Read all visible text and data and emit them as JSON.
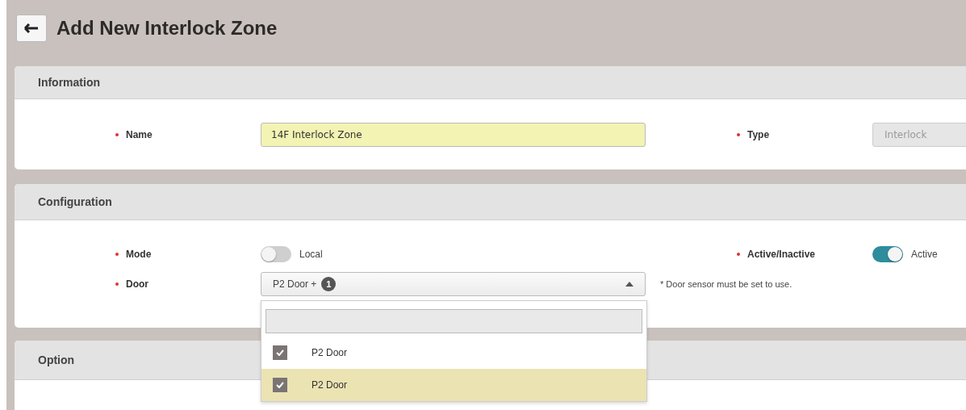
{
  "page": {
    "title": "Add New Interlock Zone"
  },
  "sections": [
    {
      "title": "Information",
      "kind": "information"
    },
    {
      "title": "Configuration",
      "kind": "configuration"
    },
    {
      "title": "Option",
      "kind": "option"
    }
  ],
  "information": {
    "name": {
      "label": "Name",
      "required": true,
      "value": "14F Interlock Zone"
    },
    "type": {
      "label": "Type",
      "required": true,
      "value": "Interlock",
      "disabled": true
    }
  },
  "configuration": {
    "mode": {
      "label": "Mode",
      "required": true,
      "on": false,
      "text": "Local"
    },
    "active": {
      "label": "Active/Inactive",
      "required": true,
      "on": true,
      "text": "Active"
    },
    "door": {
      "label": "Door",
      "required": true,
      "value": "P2 Door +",
      "count": "1",
      "expanded": true,
      "hint": "* Door sensor must be set to use.",
      "options": [
        {
          "label": "P2 Door",
          "checked": true,
          "highlighted": false
        },
        {
          "label": "P2 Door",
          "checked": true,
          "highlighted": true
        }
      ]
    }
  }
}
